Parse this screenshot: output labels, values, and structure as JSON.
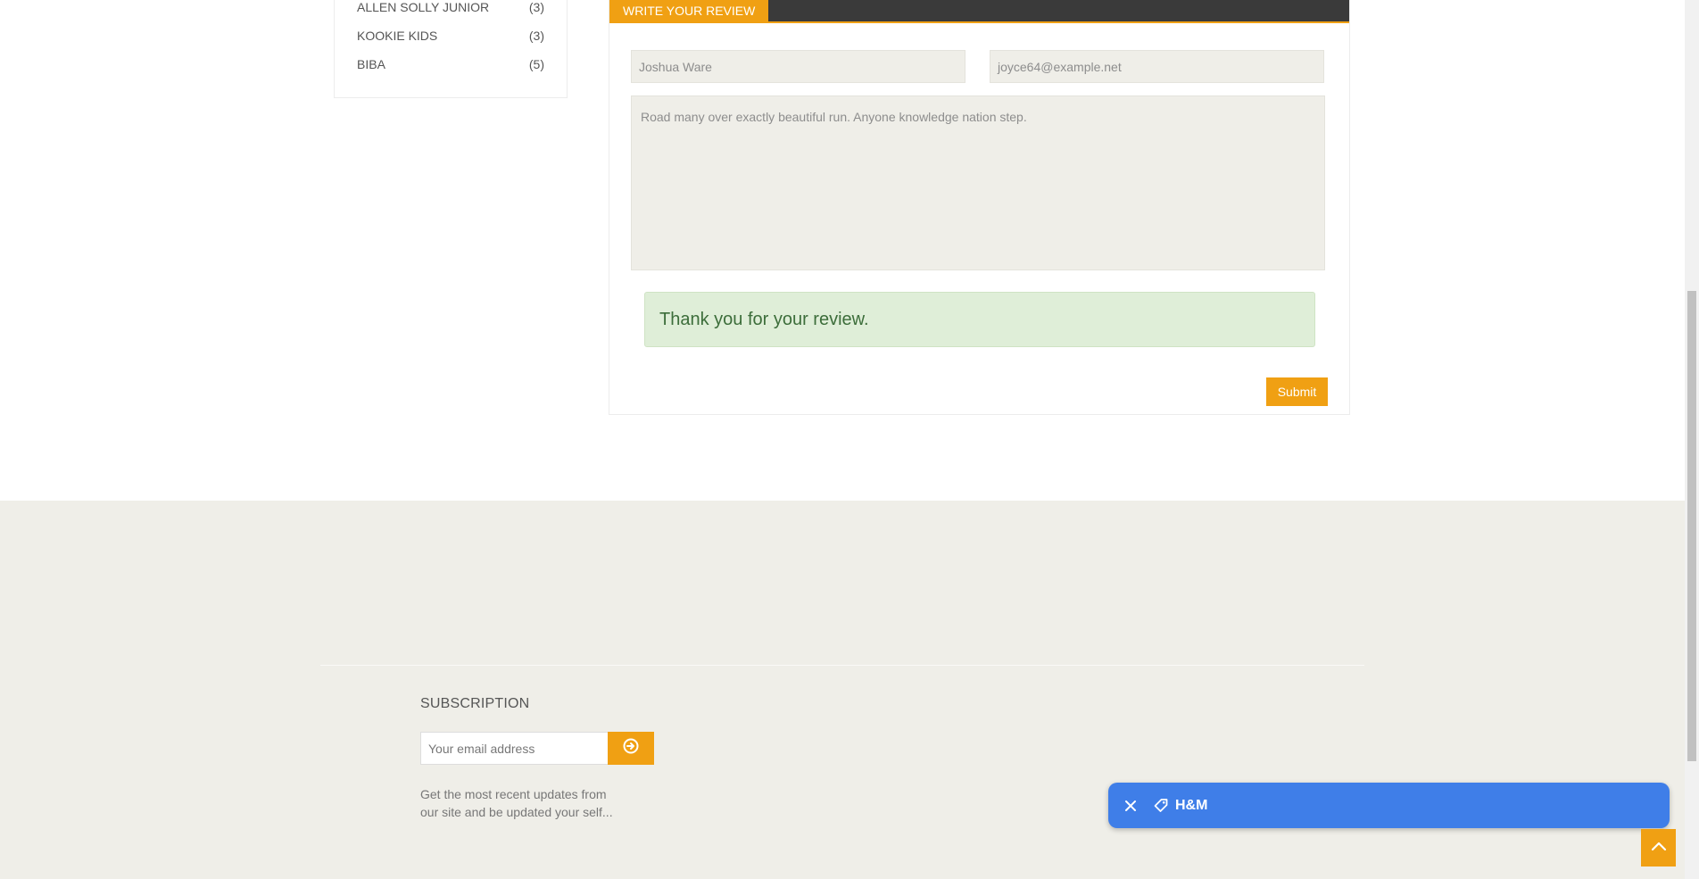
{
  "sidebar": {
    "brands": [
      {
        "name": "ALLEN SOLLY JUNIOR",
        "count": "(3)"
      },
      {
        "name": "KOOKIE KIDS",
        "count": "(3)"
      },
      {
        "name": "BIBA",
        "count": "(5)"
      }
    ]
  },
  "review": {
    "tab_label": "WRITE YOUR REVIEW",
    "name_value": "Joshua Ware",
    "email_value": "joyce64@example.net",
    "comment_value": "Road many over exactly beautiful run. Anyone knowledge nation step.",
    "success_message": "Thank you for your review.",
    "submit_label": "Submit"
  },
  "footer": {
    "subscription_title": "SUBSCRIPTION",
    "email_placeholder": "Your email address",
    "description": "Get the most recent updates from our site and be updated your self..."
  },
  "toast": {
    "label": "H&M"
  },
  "colors": {
    "accent": "#f0a013",
    "dark_header": "#3a3a3a",
    "footer_bg": "#efeee8",
    "success_bg": "#dfeed8",
    "toast_bg": "#3f7ee8"
  }
}
